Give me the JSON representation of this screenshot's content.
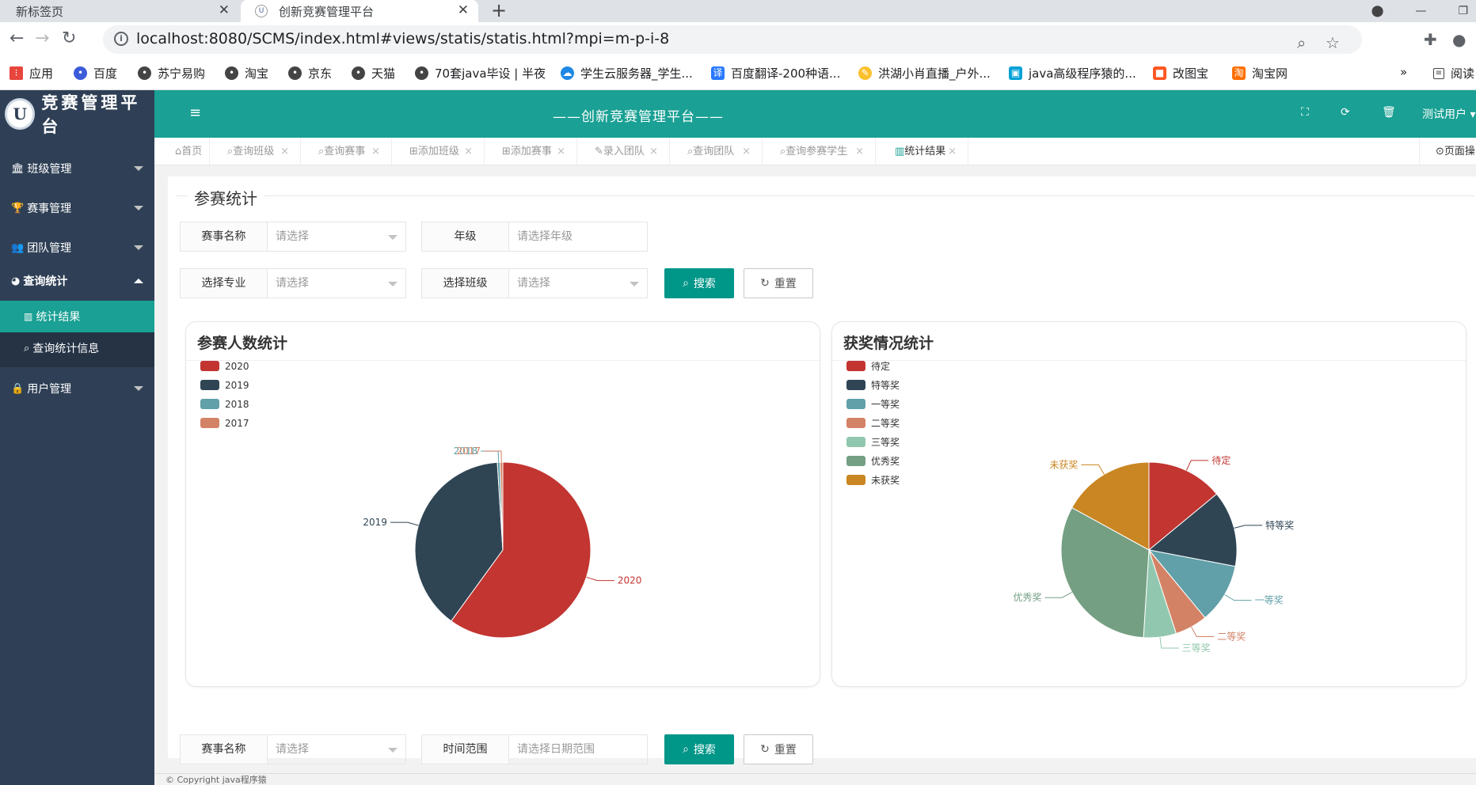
{
  "browser": {
    "tabs": [
      {
        "label": "新标签页"
      },
      {
        "label": "创新竞赛管理平台"
      }
    ],
    "url": "localhost:8080/SCMS/index.html#views/statis/statis.html?mpi=m-p-i-8",
    "bookmarks": [
      "应用",
      "百度",
      "苏宁易购",
      "淘宝",
      "京东",
      "天猫",
      "70套java毕设 | 半夜",
      "学生云服务器_学生...",
      "百度翻译-200种语...",
      "洪湖小肖直播_户外...",
      "java高级程序猿的...",
      "改图宝",
      "淘宝网",
      "阅读"
    ],
    "bookmark_overflow": "»"
  },
  "sidebar": {
    "logo_text": "竞赛管理平台",
    "logo_mark": "U",
    "items": [
      {
        "label": "班级管理",
        "icon": "bank-icon"
      },
      {
        "label": "赛事管理",
        "icon": "trophy-icon"
      },
      {
        "label": "团队管理",
        "icon": "users-icon"
      },
      {
        "label": "查询统计",
        "icon": "pie-chart-icon"
      },
      {
        "label": "用户管理",
        "icon": "lock-icon"
      }
    ],
    "subitems": [
      {
        "label": "统计结果",
        "icon": "bar-chart-icon"
      },
      {
        "label": "查询统计信息",
        "icon": "search-icon"
      }
    ]
  },
  "header": {
    "title": "——创新竞赛管理平台——",
    "user": "测试用户"
  },
  "page_tabs": [
    {
      "label": "首页",
      "icon": "home-icon"
    },
    {
      "label": "查询班级",
      "icon": "search-icon"
    },
    {
      "label": "查询赛事",
      "icon": "search-icon"
    },
    {
      "label": "添加班级",
      "icon": "plus-square-icon"
    },
    {
      "label": "添加赛事",
      "icon": "plus-square-icon"
    },
    {
      "label": "录入团队",
      "icon": "edit-icon"
    },
    {
      "label": "查询团队",
      "icon": "search-icon"
    },
    {
      "label": "查询参赛学生",
      "icon": "search-icon"
    },
    {
      "label": "统计结果",
      "icon": "bar-chart-icon"
    }
  ],
  "page_op_label": "页面操",
  "section_title": "参赛统计",
  "form1": {
    "contest_label": "赛事名称",
    "contest_placeholder": "请选择",
    "grade_label": "年级",
    "grade_placeholder": "请选择年级",
    "major_label": "选择专业",
    "major_placeholder": "请选择",
    "class_label": "选择班级",
    "class_placeholder": "请选择",
    "search": "搜索",
    "reset": "重置"
  },
  "form2": {
    "contest_label": "赛事名称",
    "contest_placeholder": "请选择",
    "time_label": "时间范围",
    "time_placeholder": "请选择日期范围",
    "search": "搜索",
    "reset": "重置"
  },
  "footer": "© Copyright java程序猿",
  "colors": {
    "sidebar": "#2f4056",
    "header": "#1aa094",
    "primary": "#009688"
  },
  "chart_data": [
    {
      "type": "pie",
      "title": "参赛人数统计",
      "legend_position": "top-left",
      "categories": [
        "2020",
        "2019",
        "2018",
        "2017"
      ],
      "values": [
        60,
        39,
        0.5,
        0.5
      ],
      "colors": [
        "#c23531",
        "#2f4554",
        "#61a0a8",
        "#d48265"
      ]
    },
    {
      "type": "pie",
      "title": "获奖情况统计",
      "legend_position": "top-left",
      "categories": [
        "待定",
        "特等奖",
        "一等奖",
        "二等奖",
        "三等奖",
        "优秀奖",
        "未获奖"
      ],
      "values": [
        14,
        14,
        11,
        6,
        6,
        32,
        17
      ],
      "colors": [
        "#c23531",
        "#2f4554",
        "#61a0a8",
        "#d48265",
        "#91c7ae",
        "#749f83",
        "#ca8622"
      ]
    }
  ]
}
